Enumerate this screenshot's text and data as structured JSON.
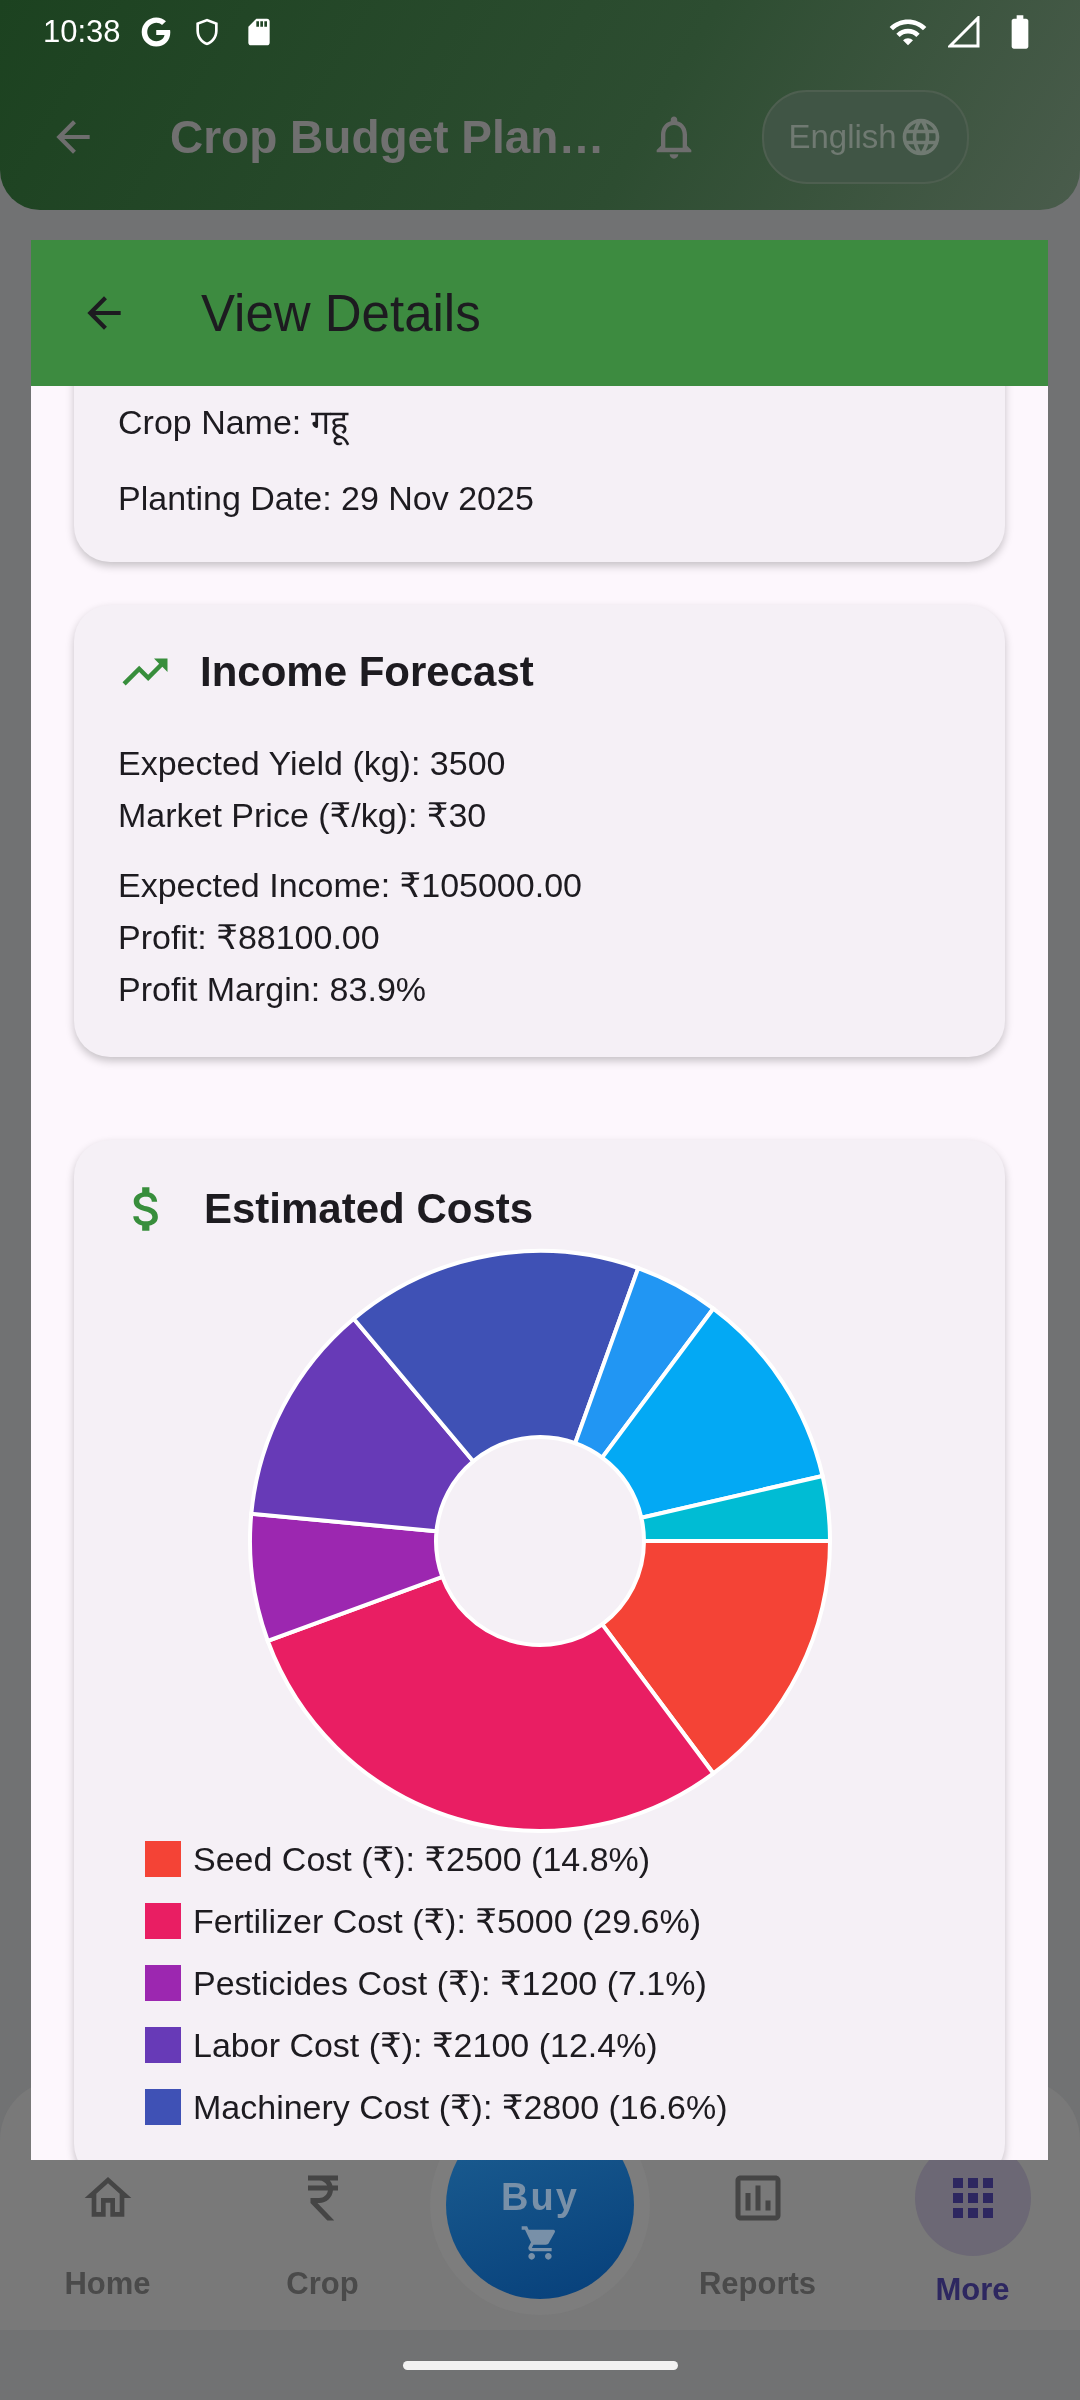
{
  "status_bar": {
    "time": "10:38"
  },
  "app_bar": {
    "title": "Crop Budget Plan…",
    "language": "English"
  },
  "dialog": {
    "title": "View Details",
    "crop_card": {
      "lines": [
        "Crop Name: गहू",
        "Planting Date: 29 Nov 2025"
      ]
    },
    "income_card": {
      "title": "Income Forecast",
      "groups": [
        [
          "Expected Yield (kg): 3500",
          "Market Price (₹/kg): ₹30"
        ],
        [
          "Expected Income: ₹105000.00",
          "Profit: ₹88100.00",
          "Profit Margin: 83.9%"
        ]
      ]
    },
    "costs_card": {
      "title": "Estimated Costs",
      "chart_data": {
        "type": "donut",
        "colors": [
          "#f44336",
          "#e91e63",
          "#9c27b0",
          "#673ab7",
          "#3f51b5",
          "#2196f3",
          "#03a9f4",
          "#00bcd4"
        ],
        "values": [
          14.8,
          29.6,
          7.1,
          12.4,
          16.6,
          4.7,
          11.2,
          3.6
        ]
      },
      "legend": [
        {
          "label": "Seed Cost (₹): ₹2500 (14.8%)",
          "color": "#f44336"
        },
        {
          "label": "Fertilizer Cost (₹): ₹5000 (29.6%)",
          "color": "#e91e63"
        },
        {
          "label": "Pesticides Cost (₹): ₹1200 (7.1%)",
          "color": "#9c27b0"
        },
        {
          "label": "Labor Cost (₹): ₹2100 (12.4%)",
          "color": "#673ab7"
        },
        {
          "label": "Machinery Cost (₹): ₹2800 (16.6%)",
          "color": "#3f51b5"
        }
      ]
    }
  },
  "bottom_nav": {
    "items": [
      {
        "kind": "home",
        "label": "Home",
        "selected": false
      },
      {
        "kind": "rupee",
        "label": "Crop",
        "selected": false
      },
      {
        "kind": "buy",
        "label": "Buy",
        "selected": false
      },
      {
        "kind": "reports",
        "label": "Reports",
        "selected": false
      },
      {
        "kind": "more",
        "label": "More",
        "selected": true
      }
    ]
  }
}
